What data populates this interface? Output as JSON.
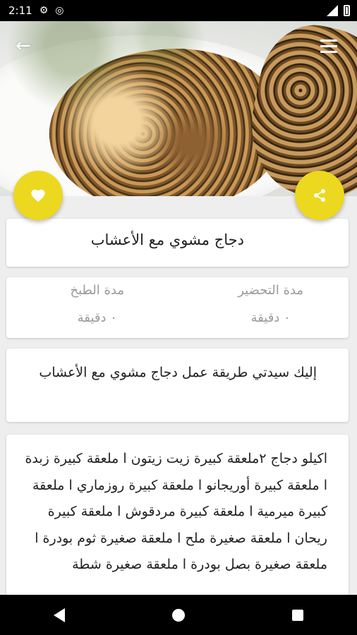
{
  "status_bar": {
    "time": "2:11"
  },
  "recipe": {
    "title": "دجاج مشوي مع الأعشاب",
    "prep_label": "مدة التحضير",
    "prep_value": "٠ دقيقة",
    "cook_label": "مدة الطبخ",
    "cook_value": "٠ دقيقة",
    "description": "إليك سيدتي طريقة عمل دجاج مشوي مع الأعشاب",
    "ingredients": "اكيلو دجاج ٢ملعقة كبيرة زيت زيتون ا ملعقة كبيرة زبدة ا ملعقة كبيرة أوريجانو ا ملعقة كبيرة روزماري ا ملعقة كبيرة ميرمية ا ملعقة كبيرة مردقوش ا ملعقة كبيرة ريحان ا ملعقة صغيرة ملح ا ملعقة صغيرة ثوم بودرة ا ملعقة صغيرة بصل بودرة ا ملعقة صغيرة شطة"
  },
  "colors": {
    "accent": "#ecd81e",
    "background": "#eeeeee"
  }
}
